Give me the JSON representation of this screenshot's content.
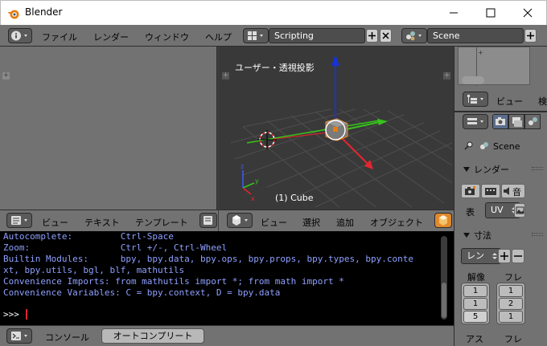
{
  "window": {
    "title": "Blender"
  },
  "header": {
    "menu": [
      "ファイル",
      "レンダー",
      "ウィンドウ",
      "ヘルプ"
    ],
    "screen_layout": "Scripting",
    "scene": "Scene"
  },
  "viewport": {
    "label": "ユーザー・透視投影",
    "object_label": "(1) Cube",
    "menu": [
      "ビュー",
      "選択",
      "追加",
      "オブジェクト"
    ]
  },
  "text_editor_header": {
    "menu": [
      "ビュー",
      "テキスト",
      "テンプレート"
    ]
  },
  "console": {
    "lines": [
      "Autocomplete:         Ctrl-Space",
      "Zoom:                 Ctrl +/-, Ctrl-Wheel",
      "Builtin Modules:      bpy, bpy.data, bpy.ops, bpy.props, bpy.types, bpy.conte",
      "xt, bpy.utils, bgl, blf, mathutils",
      "Convenience Imports: from mathutils import *; from math import *",
      "Convenience Variables: C = bpy.context, D = bpy.data"
    ],
    "prompt": ">>> ",
    "footer_label": "コンソール",
    "autocomplete_button": "オートコンプリート"
  },
  "properties": {
    "outliner_menu": [
      "ビュー",
      "検"
    ],
    "scene_label": "Scene",
    "render_panel": "レンダー",
    "render_display_label": "表",
    "render_display_value": "UV",
    "dimensions_panel": "寸法",
    "preset_label": "レン",
    "resolution_label": "解像",
    "frame_label": "フレ",
    "res_values": [
      "1",
      "1",
      "5"
    ],
    "frame_values": [
      "1",
      "2",
      "1"
    ],
    "aspect_label": "アス",
    "frame_label2": "フレ"
  },
  "colors": {
    "accent_orange": "#e87d0d",
    "axis_red": "#e3262f",
    "axis_green": "#35c41a",
    "axis_blue": "#1732d6",
    "console_text": "#8ea0ff"
  }
}
